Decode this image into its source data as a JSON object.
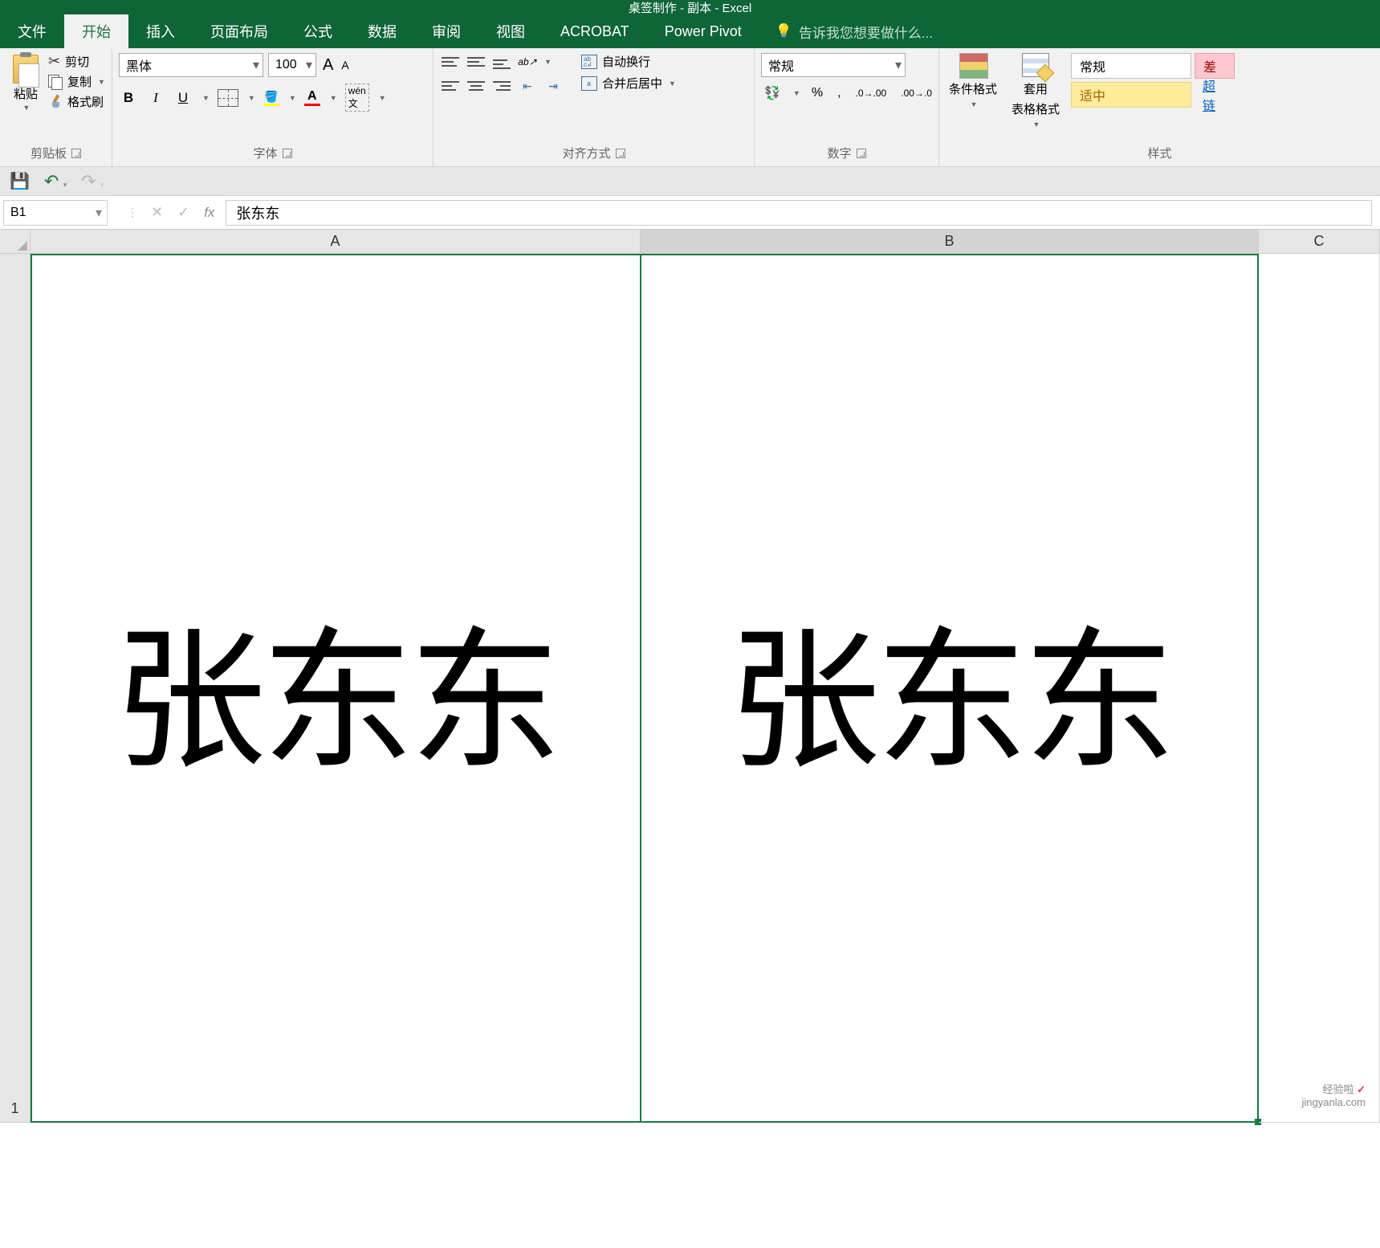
{
  "title": "桌签制作 - 副本 - Excel",
  "tabs": {
    "file": "文件",
    "home": "开始",
    "insert": "插入",
    "layout": "页面布局",
    "formulas": "公式",
    "data": "数据",
    "review": "审阅",
    "view": "视图",
    "acrobat": "ACROBAT",
    "powerpivot": "Power Pivot"
  },
  "tellme": "告诉我您想要做什么...",
  "clipboard": {
    "paste": "粘贴",
    "cut": "剪切",
    "copy": "复制",
    "painter": "格式刷",
    "group": "剪贴板"
  },
  "font": {
    "name": "黑体",
    "size": "100",
    "wen": "wén",
    "wen2": "文",
    "group": "字体"
  },
  "alignment": {
    "wrap": "自动换行",
    "merge": "合并后居中",
    "group": "对齐方式"
  },
  "number": {
    "format": "常规",
    "group": "数字"
  },
  "styles": {
    "cond": "条件格式",
    "table": "套用\n表格格式",
    "table1": "套用",
    "table2": "表格格式",
    "normal": "常规",
    "bad": "差",
    "neutral": "适中",
    "hyperlink": "超链",
    "group": "样式"
  },
  "namebox": "B1",
  "formula_value": "张东东",
  "columns": {
    "A": "A",
    "B": "B",
    "C": "C"
  },
  "rows": {
    "r1": "1"
  },
  "cells": {
    "A1": "张东东",
    "B1": "张东东"
  },
  "watermark": {
    "line1": "经验啦",
    "line2": "jingyanla.com"
  }
}
